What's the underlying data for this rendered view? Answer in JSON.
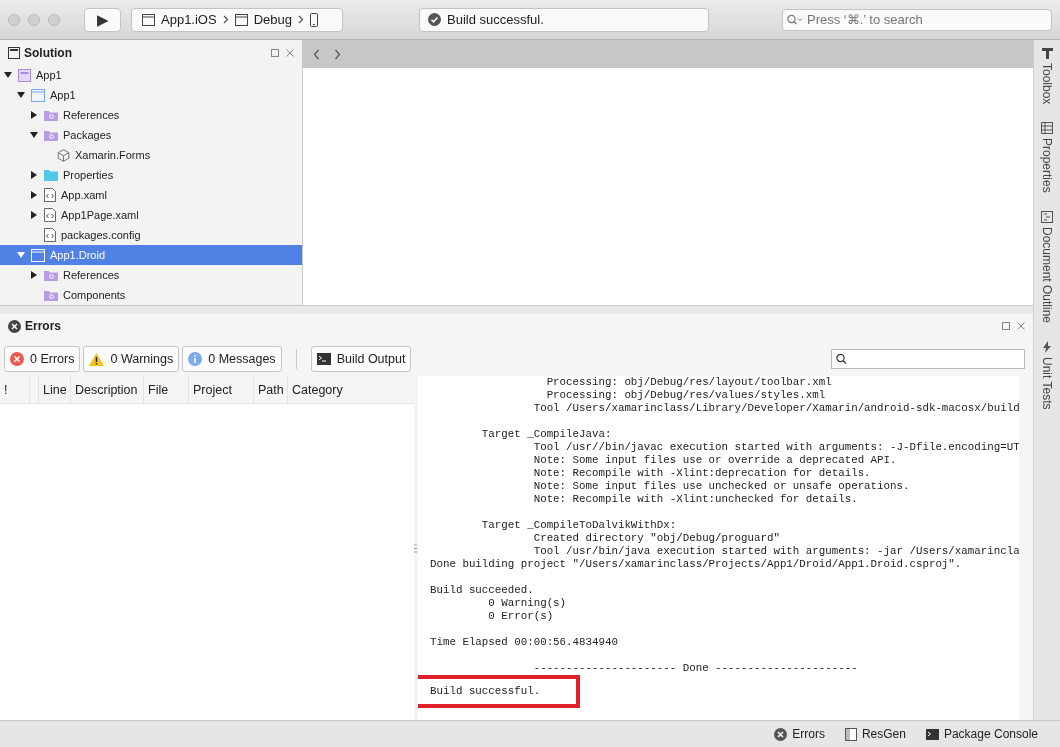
{
  "toolbar": {
    "run_label": "▶",
    "breadcrumbs": [
      {
        "label": "App1.iOS",
        "kind": "window"
      },
      {
        "label": "Debug",
        "kind": "window"
      },
      {
        "kind": "device"
      }
    ],
    "status": "Build successful.",
    "search": {
      "placeholder": "Press ‘⌘.’ to search"
    }
  },
  "solution": {
    "title": "Solution",
    "tree": [
      {
        "label": "App1",
        "kind": "solution",
        "expanded": true,
        "selected": false,
        "children": [
          {
            "label": "App1",
            "kind": "project",
            "expanded": true,
            "selected": false,
            "children": [
              {
                "label": "References",
                "kind": "refs",
                "expanded": false,
                "selected": false
              },
              {
                "label": "Packages",
                "kind": "refs",
                "expanded": true,
                "selected": false,
                "children": [
                  {
                    "label": "Xamarin.Forms",
                    "kind": "package",
                    "selected": false
                  }
                ]
              },
              {
                "label": "Properties",
                "kind": "folder",
                "expanded": false,
                "selected": false
              },
              {
                "label": "App.xaml",
                "kind": "file",
                "expanded": false,
                "selected": false
              },
              {
                "label": "App1Page.xaml",
                "kind": "file",
                "expanded": false,
                "selected": false
              },
              {
                "label": "packages.config",
                "kind": "file",
                "selected": false
              }
            ]
          },
          {
            "label": "App1.Droid",
            "kind": "project",
            "expanded": true,
            "selected": true,
            "children": [
              {
                "label": "References",
                "kind": "refs",
                "expanded": false,
                "selected": false
              },
              {
                "label": "Components",
                "kind": "refs",
                "selected": false
              }
            ]
          }
        ]
      }
    ]
  },
  "side_tabs": [
    {
      "label": "Toolbox",
      "kind": "toolbox"
    },
    {
      "label": "Properties",
      "kind": "properties"
    },
    {
      "label": "Document Outline",
      "kind": "outline"
    },
    {
      "label": "Unit Tests",
      "kind": "tests"
    }
  ],
  "errors_pad": {
    "title": "Errors",
    "filters": [
      {
        "label": "0 Errors",
        "kind": "error"
      },
      {
        "label": "0 Warnings",
        "kind": "warning"
      },
      {
        "label": "0 Messages",
        "kind": "info"
      }
    ],
    "build_output": "Build Output",
    "columns": [
      "!",
      null,
      "Line",
      "Description",
      "File",
      "Project",
      "Path",
      "Category"
    ]
  },
  "output": {
    "blocks": [
      [
        "                  Processing: obj/Debug/res/layout/toolbar.xml",
        "                  Processing: obj/Debug/res/values/styles.xml",
        "                Tool /Users/xamarinclass/Library/Developer/Xamarin/android-sdk-macosx/build"
      ],
      [
        "        Target _CompileJava:",
        "                Tool /usr//bin/javac execution started with arguments: -J-Dfile.encoding=UT",
        "                Note: Some input files use or override a deprecated API.",
        "                Note: Recompile with -Xlint:deprecation for details.",
        "                Note: Some input files use unchecked or unsafe operations.",
        "                Note: Recompile with -Xlint:unchecked for details."
      ],
      [
        "        Target _CompileToDalvikWithDx:",
        "                Created directory \"obj/Debug/proguard\"",
        "                Tool /usr/bin/java execution started with arguments: -jar /Users/xamarincla",
        "Done building project \"/Users/xamarinclass/Projects/App1/Droid/App1.Droid.csproj\"."
      ],
      [
        "Build succeeded.",
        "         0 Warning(s)",
        "         0 Error(s)"
      ],
      [
        "Time Elapsed 00:00:56.4834940"
      ],
      [
        "                ---------------------- Done ----------------------"
      ]
    ],
    "highlighted": "Build successful."
  },
  "status_bar": [
    {
      "label": "Errors",
      "kind": "errors"
    },
    {
      "label": "ResGen",
      "kind": "resgen"
    },
    {
      "label": "Package Console",
      "kind": "console"
    }
  ]
}
